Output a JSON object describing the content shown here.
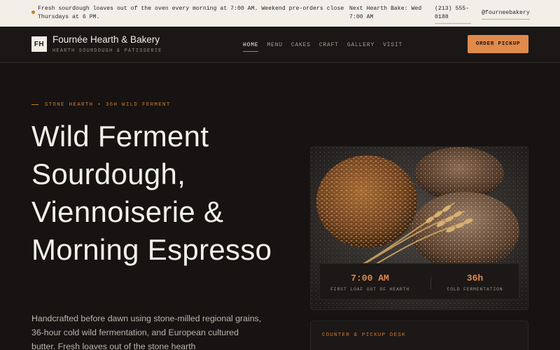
{
  "announcement": {
    "message": "Fresh sourdough loaves out of the oven every morning at 7:00 AM. Weekend pre-orders close Thursdays at 6 PM.",
    "next_bake": "Next Hearth Bake: Wed 7:00 AM",
    "phone": "(213) 555-0188",
    "social_handle": "@fourneebakery"
  },
  "header": {
    "logo_initials": "FH",
    "brand_name": "Fournée Hearth & Bakery",
    "tagline": "HEARTH SOURDOUGH & PATISSERIE",
    "nav": [
      {
        "label": "HOME",
        "active": true
      },
      {
        "label": "MENU",
        "active": false
      },
      {
        "label": "CAKES",
        "active": false
      },
      {
        "label": "CRAFT",
        "active": false
      },
      {
        "label": "GALLERY",
        "active": false
      },
      {
        "label": "VISIT",
        "active": false
      }
    ],
    "cta_label": "ORDER PICKUP"
  },
  "hero": {
    "eyebrow": "STONE HEARTH • 36H WILD FERMENT",
    "headline": "Wild Ferment Sourdough, Viennoiserie & Morning Espresso",
    "lede": "Handcrafted before dawn using stone-milled regional grains, 36-hour cold wild fermentation, and European cultured butter. Fresh loaves out of the stone hearth"
  },
  "stats": [
    {
      "value": "7:00 AM",
      "label": "FIRST LOAF OUT OF HEARTH"
    },
    {
      "value": "36h",
      "label": "COLD FERMENTATION"
    }
  ],
  "counter": {
    "title": "COUNTER & PICKUP DESK"
  },
  "colors": {
    "background": "#161312",
    "accent": "#e08a4c",
    "topbar": "#f2eee8"
  }
}
